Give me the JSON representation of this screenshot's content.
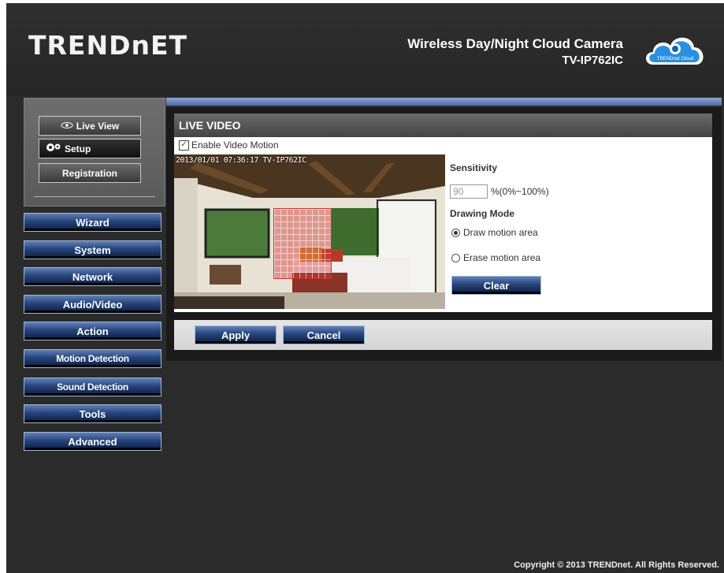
{
  "brand": {
    "logo": "TRENDnET",
    "cloud_label": "TRENDnet Cloud"
  },
  "product": {
    "title": "Wireless Day/Night Cloud Camera",
    "model": "TV-IP762IC"
  },
  "left_panel": {
    "live_view": "Live View",
    "setup": "Setup",
    "registration": "Registration"
  },
  "nav": {
    "wizard": "Wizard",
    "system": "System",
    "network": "Network",
    "audio_video": "Audio/Video",
    "action": "Action",
    "motion_detection": "Motion Detection",
    "sound_detection": "Sound Detection",
    "tools": "Tools",
    "advanced": "Advanced"
  },
  "section": {
    "title": "LIVE VIDEO"
  },
  "motion": {
    "enable_label": "Enable Video Motion",
    "enabled": true,
    "timestamp": "2013/01/01 07:36:17 TV-IP762IC",
    "sensitivity_label": "Sensitivity",
    "sensitivity_value": "90",
    "sensitivity_range": "%(0%~100%)",
    "drawing_mode_label": "Drawing Mode",
    "draw_label": "Draw motion area",
    "erase_label": "Erase motion area",
    "clear_label": "Clear"
  },
  "actions": {
    "apply": "Apply",
    "cancel": "Cancel"
  },
  "footer": {
    "copyright": "Copyright © 2013 TRENDnet. All Rights Reserved."
  },
  "colors": {
    "nav_top": "#5f80b8",
    "nav_bottom": "#091c3f",
    "accent_bar": "#8ea6d0",
    "motion_grid": "#d23c3c"
  }
}
